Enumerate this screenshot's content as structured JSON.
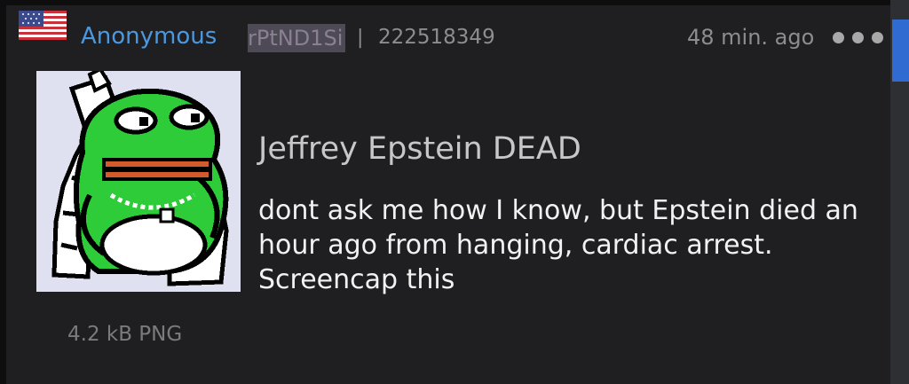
{
  "post": {
    "flag_icon": "us-flag-icon",
    "name": "Anonymous",
    "poster_id": "rPtND1Si",
    "separator": "|",
    "post_number": "222518349",
    "time_ago": "48 min. ago",
    "more_icon": "more-dots-icon",
    "subject": "Jeffrey Epstein DEAD",
    "comment": "dont ask me how I know, but Epstein died an hour ago from hanging, cardiac arrest. Screencap this",
    "file_info": "4.2 kB PNG"
  },
  "colors": {
    "name": "#4c98df",
    "accent_scrollbar": "#2f6bd0",
    "background": "#1f1f21"
  }
}
